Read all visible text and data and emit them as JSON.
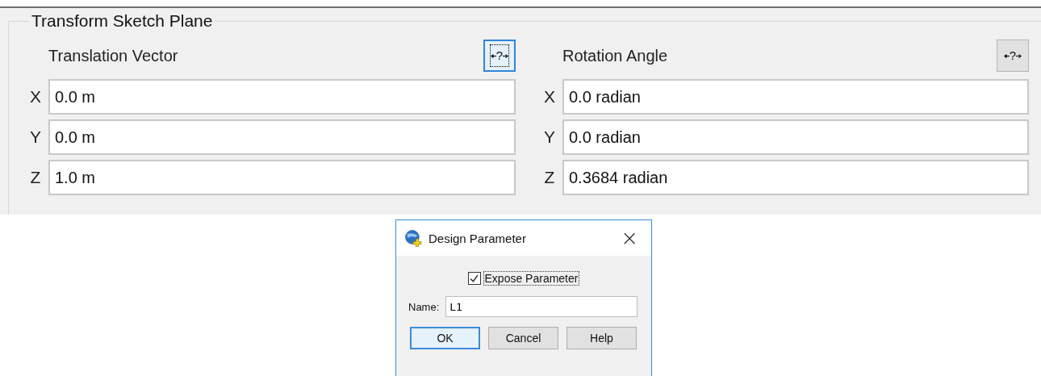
{
  "group": {
    "title": "Transform Sketch Plane",
    "columns": [
      {
        "heading": "Translation Vector",
        "button": {
          "label": "?",
          "focused": true
        },
        "fields": [
          {
            "axis": "X",
            "value": "0.0 m"
          },
          {
            "axis": "Y",
            "value": "0.0 m"
          },
          {
            "axis": "Z",
            "value": "1.0 m"
          }
        ]
      },
      {
        "heading": "Rotation Angle",
        "button": {
          "label": "?",
          "focused": false
        },
        "fields": [
          {
            "axis": "X",
            "value": "0.0 radian"
          },
          {
            "axis": "Y",
            "value": "0.0 radian"
          },
          {
            "axis": "Z",
            "value": "0.3684 radian"
          }
        ]
      }
    ]
  },
  "dialog": {
    "title": "Design Parameter",
    "close": "×",
    "checkbox": {
      "label": "Expose Parameter",
      "checked": true
    },
    "name_label": "Name:",
    "name_value": "L1",
    "buttons": [
      {
        "label": "OK",
        "default": true
      },
      {
        "label": "Cancel",
        "default": false
      },
      {
        "label": "Help",
        "default": false
      }
    ]
  }
}
